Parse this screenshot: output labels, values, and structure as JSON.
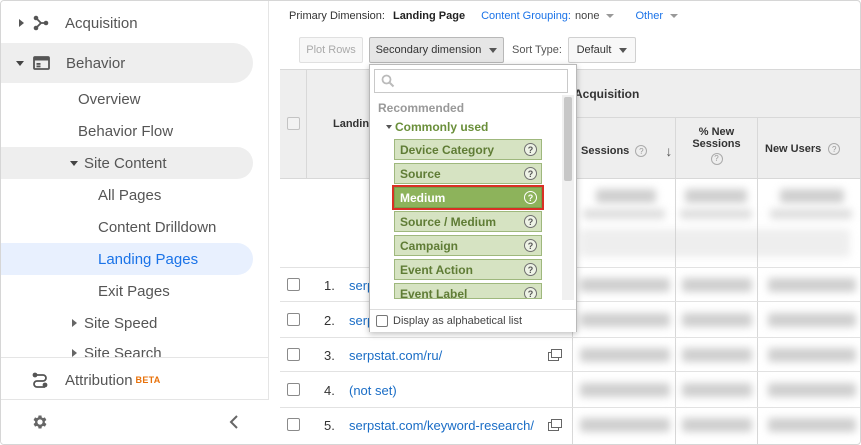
{
  "sidebar": {
    "items": [
      {
        "label": "Acquisition"
      },
      {
        "label": "Behavior"
      },
      {
        "label": "Overview"
      },
      {
        "label": "Behavior Flow"
      },
      {
        "label": "Site Content"
      },
      {
        "label": "All Pages"
      },
      {
        "label": "Content Drilldown"
      },
      {
        "label": "Landing Pages"
      },
      {
        "label": "Exit Pages"
      },
      {
        "label": "Site Speed"
      },
      {
        "label": "Site Search"
      },
      {
        "label": "Attribution",
        "badge": "BETA"
      }
    ],
    "active_item": "Landing Pages"
  },
  "toolbar": {
    "primary_dimension_label": "Primary Dimension:",
    "primary_dimension_value": "Landing Page",
    "content_grouping_label": "Content Grouping:",
    "content_grouping_value": "none",
    "other_label": "Other",
    "plot_rows": "Plot Rows",
    "secondary_dimension": "Secondary dimension",
    "sort_type_label": "Sort Type:",
    "sort_type_value": "Default"
  },
  "table": {
    "header_group": "Acquisition",
    "landing_col": "Landing",
    "columns": [
      {
        "label": "Sessions"
      },
      {
        "label": "% New Sessions"
      },
      {
        "label": "New Users"
      }
    ],
    "rows": [
      {
        "num": "1.",
        "page": "serp"
      },
      {
        "num": "2.",
        "page": "serp"
      },
      {
        "num": "3.",
        "page": "serpstat.com/ru/"
      },
      {
        "num": "4.",
        "page": "(not set)"
      },
      {
        "num": "5.",
        "page": "serpstat.com/keyword-research/"
      }
    ]
  },
  "dropdown": {
    "search_placeholder": "",
    "section_label": "Recommended",
    "group_label": "Commonly used",
    "items": [
      {
        "label": "Device Category",
        "selected": false
      },
      {
        "label": "Source",
        "selected": false
      },
      {
        "label": "Medium",
        "selected": true
      },
      {
        "label": "Source / Medium",
        "selected": false
      },
      {
        "label": "Campaign",
        "selected": false
      },
      {
        "label": "Event Action",
        "selected": false
      },
      {
        "label": "Event Label",
        "selected": false
      }
    ],
    "footer_checkbox": "Display as alphabetical list",
    "footer_checked": false
  },
  "colors": {
    "accent": "#1a73e8",
    "item_bg": "#d6e3c2",
    "item_selected_bg": "#8db35b",
    "selection_outline": "#d93025"
  },
  "icons": {
    "acquisition": "acquisition-icon",
    "behavior": "behavior-icon",
    "attribution": "attribution-icon",
    "settings": "gear-icon",
    "collapse": "chevron-left-icon"
  }
}
